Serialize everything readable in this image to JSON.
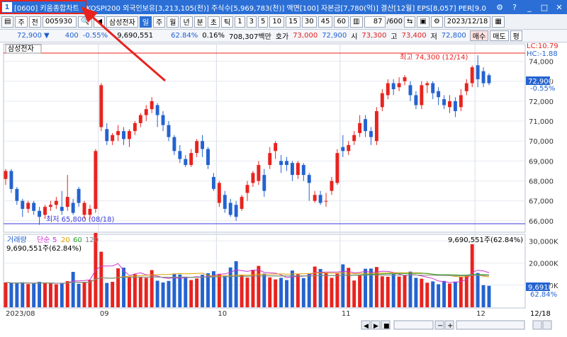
{
  "title": {
    "num": "1",
    "text": "[0600] 키움종합차트 - KOSPI200 외국인보유[3,213,105(천)] 주식수[5,969,783(천)] 액면[100] 자본금[7,780(억)] 결산[12월] EPS[8,057] PER[9.0"
  },
  "toolbar": {
    "type_label": "주",
    "jeon_label": "전",
    "code": "005930",
    "name": "삼성전자",
    "period_tabs": [
      "일",
      "주",
      "월",
      "년",
      "분",
      "초",
      "틱"
    ],
    "intervals": [
      "1",
      "3",
      "5",
      "10",
      "15",
      "30",
      "45",
      "60"
    ],
    "count": "87",
    "count_total": "/600",
    "date": "2023/12/18"
  },
  "quote": {
    "price": "72,900",
    "change": "400",
    "change_pct": "-0.55%",
    "volume": "9,690,551",
    "vol_ratio": "62.84%",
    "turnover": "0.16%",
    "amount": "708,307백만",
    "bid_label": "호가",
    "bid": "73,000",
    "ask": "72,900",
    "open_label": "시",
    "open": "73,300",
    "high_label": "고",
    "high": "73,400",
    "low_label": "저",
    "low": "72,800",
    "buy_label": "매수",
    "sell_label": "매도",
    "flat_label": "평"
  },
  "chart": {
    "stock_label": "삼성전자",
    "high_annot": "최고 74,300 (12/14)",
    "low_annot": "최저 65,800 (08/18)",
    "lc_label": "LC:10.79",
    "hc_label": "HC:-1.88",
    "last_price_tag": "72,900",
    "last_pct_tag": "-0.55%",
    "price_ticks": [
      "74,000",
      "73,000",
      "72,000",
      "71,000",
      "70,000",
      "69,000",
      "68,000",
      "67,000",
      "66,000"
    ],
    "volume_legend": [
      "거래량",
      "단순",
      "5",
      "20",
      "60",
      "120"
    ],
    "volume_value_left": "9,690,551주(62.84%)",
    "volume_value_right": "9,690,551주(62.84%)",
    "volume_ticks": [
      "30,000K",
      "20,000K",
      "10,000K"
    ],
    "volume_tag": "9,691K",
    "volume_tag_pct": "62.84%",
    "x_labels": [
      "2023/08",
      "09",
      "10",
      "11",
      "12"
    ],
    "x_right_label": "12/18",
    "colors": {
      "up": "#e8231f",
      "down": "#2463d0",
      "ma5": "#cc33cc",
      "ma20": "#e0a000",
      "ma60": "#2aa02a",
      "ma120": "#888888"
    }
  },
  "chart_data": {
    "type": "candlestick",
    "ylim": [
      65500,
      74800
    ],
    "candles": [
      {
        "o": 68100,
        "c": 68500,
        "h": 68600,
        "l": 67800
      },
      {
        "o": 68500,
        "c": 67600,
        "h": 68600,
        "l": 67400
      },
      {
        "o": 67600,
        "c": 67000,
        "h": 67700,
        "l": 66800
      },
      {
        "o": 67000,
        "c": 66600,
        "h": 67100,
        "l": 66200
      },
      {
        "o": 66600,
        "c": 66900,
        "h": 67000,
        "l": 66400
      },
      {
        "o": 66900,
        "c": 66500,
        "h": 67000,
        "l": 66300
      },
      {
        "o": 66500,
        "c": 66200,
        "h": 66700,
        "l": 65800
      },
      {
        "o": 66300,
        "c": 66700,
        "h": 66800,
        "l": 66100
      },
      {
        "o": 66700,
        "c": 66800,
        "h": 67000,
        "l": 66500
      },
      {
        "o": 66800,
        "c": 67000,
        "h": 67200,
        "l": 66600
      },
      {
        "o": 66700,
        "c": 66500,
        "h": 67500,
        "l": 66300
      },
      {
        "o": 66700,
        "c": 67200,
        "h": 68300,
        "l": 66500
      },
      {
        "o": 66900,
        "c": 66400,
        "h": 67100,
        "l": 66300
      },
      {
        "o": 67600,
        "c": 66900,
        "h": 67700,
        "l": 66700
      },
      {
        "o": 66300,
        "c": 66900,
        "h": 67000,
        "l": 66100
      },
      {
        "o": 66300,
        "c": 66600,
        "h": 66800,
        "l": 66100
      },
      {
        "o": 66600,
        "c": 69500,
        "h": 69600,
        "l": 66400
      },
      {
        "o": 70700,
        "c": 72800,
        "h": 72900,
        "l": 70500
      },
      {
        "o": 70600,
        "c": 70000,
        "h": 70900,
        "l": 69800
      },
      {
        "o": 70000,
        "c": 70300,
        "h": 70400,
        "l": 69800
      },
      {
        "o": 70300,
        "c": 70500,
        "h": 70800,
        "l": 70000
      },
      {
        "o": 70500,
        "c": 70100,
        "h": 70700,
        "l": 69800
      },
      {
        "o": 70100,
        "c": 70500,
        "h": 70600,
        "l": 69700
      },
      {
        "o": 70500,
        "c": 70900,
        "h": 71000,
        "l": 70300
      },
      {
        "o": 70900,
        "c": 71300,
        "h": 71400,
        "l": 70700
      },
      {
        "o": 71300,
        "c": 71600,
        "h": 71800,
        "l": 71000
      },
      {
        "o": 71600,
        "c": 72000,
        "h": 72200,
        "l": 71400
      },
      {
        "o": 71800,
        "c": 71300,
        "h": 71900,
        "l": 70700
      },
      {
        "o": 71300,
        "c": 70800,
        "h": 71500,
        "l": 70500
      },
      {
        "o": 70800,
        "c": 70200,
        "h": 71000,
        "l": 70000
      },
      {
        "o": 70200,
        "c": 69500,
        "h": 70300,
        "l": 69300
      },
      {
        "o": 69500,
        "c": 69100,
        "h": 69800,
        "l": 68900
      },
      {
        "o": 69100,
        "c": 68800,
        "h": 69300,
        "l": 68700
      },
      {
        "o": 68800,
        "c": 69400,
        "h": 69600,
        "l": 68700
      },
      {
        "o": 69400,
        "c": 70000,
        "h": 70100,
        "l": 69200
      },
      {
        "o": 70000,
        "c": 69600,
        "h": 70300,
        "l": 69200
      },
      {
        "o": 69600,
        "c": 68800,
        "h": 69700,
        "l": 68600
      },
      {
        "o": 68200,
        "c": 67600,
        "h": 68400,
        "l": 67500
      },
      {
        "o": 66900,
        "c": 67900,
        "h": 68000,
        "l": 66700
      },
      {
        "o": 67300,
        "c": 66600,
        "h": 67500,
        "l": 66400
      },
      {
        "o": 66900,
        "c": 66300,
        "h": 67100,
        "l": 66200
      },
      {
        "o": 66800,
        "c": 66200,
        "h": 67000,
        "l": 66000
      },
      {
        "o": 66600,
        "c": 67200,
        "h": 67300,
        "l": 66500
      },
      {
        "o": 67400,
        "c": 67800,
        "h": 68000,
        "l": 67000
      },
      {
        "o": 67900,
        "c": 68400,
        "h": 68500,
        "l": 67700
      },
      {
        "o": 68000,
        "c": 68800,
        "h": 69000,
        "l": 67800
      },
      {
        "o": 68300,
        "c": 67500,
        "h": 68600,
        "l": 67200
      },
      {
        "o": 68800,
        "c": 69400,
        "h": 69700,
        "l": 68600
      },
      {
        "o": 69500,
        "c": 69900,
        "h": 70000,
        "l": 69100
      },
      {
        "o": 69000,
        "c": 68800,
        "h": 69300,
        "l": 68400
      },
      {
        "o": 69000,
        "c": 68800,
        "h": 69200,
        "l": 68500
      },
      {
        "o": 68900,
        "c": 68300,
        "h": 69000,
        "l": 68000
      },
      {
        "o": 68300,
        "c": 68900,
        "h": 69000,
        "l": 68100
      },
      {
        "o": 68800,
        "c": 68300,
        "h": 68900,
        "l": 68000
      },
      {
        "o": 68300,
        "c": 67900,
        "h": 68400,
        "l": 67000
      },
      {
        "o": 67000,
        "c": 67300,
        "h": 67500,
        "l": 66900
      },
      {
        "o": 67300,
        "c": 66900,
        "h": 67500,
        "l": 66800
      },
      {
        "o": 67000,
        "c": 67000,
        "h": 67400,
        "l": 66700
      },
      {
        "o": 67500,
        "c": 68000,
        "h": 68200,
        "l": 67300
      },
      {
        "o": 67900,
        "c": 69400,
        "h": 69600,
        "l": 67800
      },
      {
        "o": 69700,
        "c": 69500,
        "h": 70300,
        "l": 69200
      },
      {
        "o": 69500,
        "c": 69800,
        "h": 70000,
        "l": 69300
      },
      {
        "o": 70000,
        "c": 70300,
        "h": 70500,
        "l": 69800
      },
      {
        "o": 70400,
        "c": 70900,
        "h": 71300,
        "l": 70200
      },
      {
        "o": 71100,
        "c": 70500,
        "h": 71300,
        "l": 70200
      },
      {
        "o": 70500,
        "c": 70200,
        "h": 70700,
        "l": 69800
      },
      {
        "o": 70000,
        "c": 71500,
        "h": 71700,
        "l": 69800
      },
      {
        "o": 71700,
        "c": 72400,
        "h": 72600,
        "l": 71500
      },
      {
        "o": 72300,
        "c": 72900,
        "h": 73100,
        "l": 72100
      },
      {
        "o": 72900,
        "c": 72600,
        "h": 73100,
        "l": 72300
      },
      {
        "o": 72700,
        "c": 72900,
        "h": 73200,
        "l": 72500
      },
      {
        "o": 73000,
        "c": 73200,
        "h": 73300,
        "l": 72800
      },
      {
        "o": 72800,
        "c": 72300,
        "h": 73000,
        "l": 72000
      },
      {
        "o": 72300,
        "c": 71800,
        "h": 72500,
        "l": 71600
      },
      {
        "o": 71800,
        "c": 72800,
        "h": 73000,
        "l": 71600
      },
      {
        "o": 72800,
        "c": 72900,
        "h": 73000,
        "l": 72400
      },
      {
        "o": 72900,
        "c": 72400,
        "h": 73000,
        "l": 72100
      },
      {
        "o": 72500,
        "c": 72200,
        "h": 72700,
        "l": 71800
      },
      {
        "o": 72100,
        "c": 71800,
        "h": 72300,
        "l": 71600
      },
      {
        "o": 71700,
        "c": 72000,
        "h": 72300,
        "l": 71400
      },
      {
        "o": 72000,
        "c": 71500,
        "h": 72200,
        "l": 71200
      },
      {
        "o": 71700,
        "c": 72300,
        "h": 72600,
        "l": 71500
      },
      {
        "o": 72500,
        "c": 72900,
        "h": 73100,
        "l": 72300
      },
      {
        "o": 72900,
        "c": 73700,
        "h": 73800,
        "l": 72700
      },
      {
        "o": 73800,
        "c": 73100,
        "h": 74300,
        "l": 72700
      },
      {
        "o": 73500,
        "c": 72900,
        "h": 73700,
        "l": 72700
      },
      {
        "o": 73300,
        "c": 72900,
        "h": 73400,
        "l": 72800
      }
    ],
    "volumes": [
      11200,
      10900,
      10800,
      11300,
      10500,
      10700,
      11500,
      10900,
      10700,
      10400,
      10800,
      11800,
      16000,
      10600,
      11300,
      12300,
      33600,
      25100,
      11000,
      11500,
      17600,
      17900,
      13700,
      14900,
      13600,
      13300,
      16800,
      12000,
      11200,
      11900,
      15200,
      14800,
      13600,
      12300,
      13000,
      14700,
      15400,
      16300,
      15100,
      14100,
      18000,
      20800,
      14700,
      13400,
      16900,
      18700,
      15200,
      13500,
      12600,
      13300,
      12300,
      16600,
      14900,
      13200,
      15100,
      18400,
      17300,
      15600,
      13300,
      15200,
      19400,
      17800,
      12100,
      14400,
      17400,
      17500,
      18200,
      14000,
      13800,
      15200,
      13900,
      14600,
      16100,
      13300,
      12900,
      11100,
      11700,
      10400,
      11900,
      10700,
      11600,
      13600,
      14500,
      28500,
      15500,
      10000,
      9691
    ],
    "vol_ylim": [
      0,
      32000
    ],
    "x_month_starts": {
      "2023/08": 0,
      "09": 17,
      "10": 38,
      "11": 60,
      "12": 84
    }
  }
}
